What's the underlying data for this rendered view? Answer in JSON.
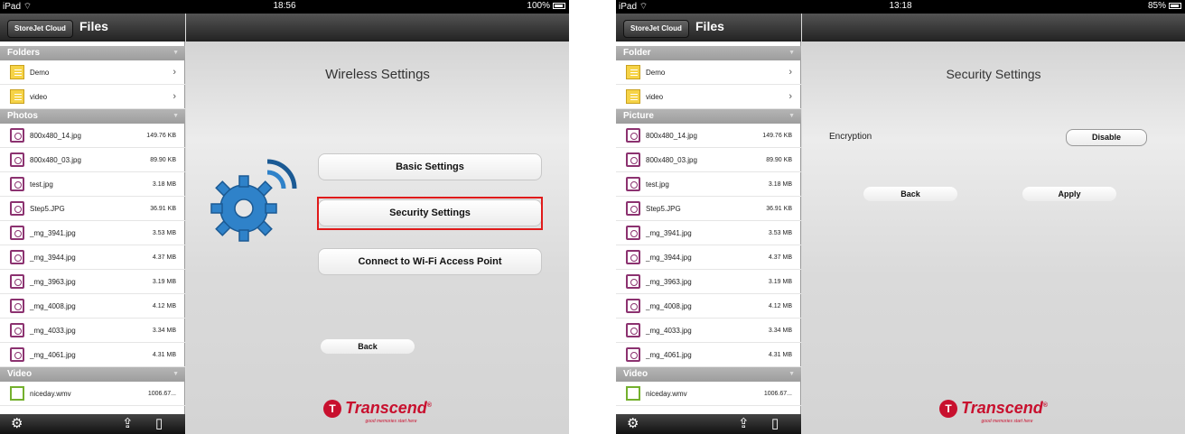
{
  "screens": [
    {
      "status": {
        "carrier": "iPad",
        "time": "18:56",
        "battery": "100%"
      },
      "nav": {
        "storejet": "StoreJet Cloud",
        "title": "Files"
      },
      "sections": [
        {
          "label": "Folders",
          "items": [
            {
              "name": "Demo",
              "type": "folder"
            },
            {
              "name": "video",
              "type": "folder"
            }
          ]
        },
        {
          "label": "Photos",
          "items": [
            {
              "name": "800x480_14.jpg",
              "size": "149.76 KB",
              "type": "photo"
            },
            {
              "name": "800x480_03.jpg",
              "size": "89.90 KB",
              "type": "photo"
            },
            {
              "name": "test.jpg",
              "size": "3.18 MB",
              "type": "photo"
            },
            {
              "name": "Step5.JPG",
              "size": "36.91 KB",
              "type": "photo"
            },
            {
              "name": "_mg_3941.jpg",
              "size": "3.53 MB",
              "type": "photo"
            },
            {
              "name": "_mg_3944.jpg",
              "size": "4.37 MB",
              "type": "photo"
            },
            {
              "name": "_mg_3963.jpg",
              "size": "3.19 MB",
              "type": "photo"
            },
            {
              "name": "_mg_4008.jpg",
              "size": "4.12 MB",
              "type": "photo"
            },
            {
              "name": "_mg_4033.jpg",
              "size": "3.34 MB",
              "type": "photo"
            },
            {
              "name": "_mg_4061.jpg",
              "size": "4.31 MB",
              "type": "photo"
            }
          ]
        },
        {
          "label": "Video",
          "items": [
            {
              "name": "niceday.wmv",
              "size": "1006.67...",
              "type": "video"
            }
          ]
        }
      ],
      "panel": {
        "title": "Wireless Settings",
        "buttons": [
          "Basic Settings",
          "Security Settings",
          "Connect to Wi-Fi Access Point"
        ],
        "back": "Back"
      }
    },
    {
      "status": {
        "carrier": "iPad",
        "time": "13:18",
        "battery": "85%"
      },
      "nav": {
        "storejet": "StoreJet Cloud",
        "title": "Files"
      },
      "sections": [
        {
          "label": "Folder",
          "items": [
            {
              "name": "Demo",
              "type": "folder"
            },
            {
              "name": "video",
              "type": "folder"
            }
          ]
        },
        {
          "label": "Picture",
          "items": [
            {
              "name": "800x480_14.jpg",
              "size": "149.76 KB",
              "type": "photo"
            },
            {
              "name": "800x480_03.jpg",
              "size": "89.90 KB",
              "type": "photo"
            },
            {
              "name": "test.jpg",
              "size": "3.18 MB",
              "type": "photo"
            },
            {
              "name": "Step5.JPG",
              "size": "36.91 KB",
              "type": "photo"
            },
            {
              "name": "_mg_3941.jpg",
              "size": "3.53 MB",
              "type": "photo"
            },
            {
              "name": "_mg_3944.jpg",
              "size": "4.37 MB",
              "type": "photo"
            },
            {
              "name": "_mg_3963.jpg",
              "size": "3.19 MB",
              "type": "photo"
            },
            {
              "name": "_mg_4008.jpg",
              "size": "4.12 MB",
              "type": "photo"
            },
            {
              "name": "_mg_4033.jpg",
              "size": "3.34 MB",
              "type": "photo"
            },
            {
              "name": "_mg_4061.jpg",
              "size": "4.31 MB",
              "type": "photo"
            }
          ]
        },
        {
          "label": "Video",
          "items": [
            {
              "name": "niceday.wmv",
              "size": "1006.67...",
              "type": "video"
            }
          ]
        }
      ],
      "panel": {
        "title": "Security Settings",
        "encryption_label": "Encryption",
        "encryption_value": "Disable",
        "back": "Back",
        "apply": "Apply"
      }
    }
  ],
  "brand": {
    "name": "Transcend",
    "mark": "®",
    "tagline": "good memories start here",
    "color": "#c8102e"
  },
  "highlight_color": "#e01a1a",
  "icons": {
    "settings": "gear-icon",
    "share": "share-icon",
    "device": "device-icon",
    "wifi": "wifi-icon",
    "wireless_gear": "wireless-gear-icon"
  }
}
